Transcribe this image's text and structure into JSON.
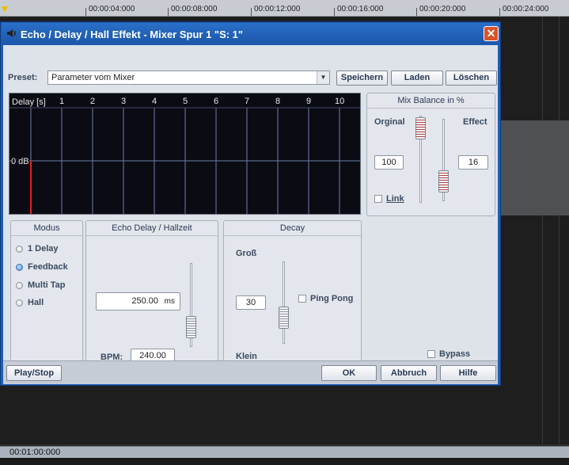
{
  "background": {
    "timeline_labels": [
      "00:00:04:000",
      "00:00:08:000",
      "00:00:12:000",
      "00:00:16:000",
      "00:00:20:000",
      "00:00:24:000"
    ],
    "status_time": "00:01:00:000"
  },
  "dialog": {
    "title": "Echo / Delay / Hall Effekt - Mixer Spur 1 \"S:  1\"",
    "close_glyph": "✕",
    "preset": {
      "label": "Preset:",
      "value": "Parameter vom Mixer",
      "save_label": "Speichern",
      "load_label": "Laden",
      "delete_label": "Löschen"
    },
    "graph": {
      "axis_label": "Delay [s]",
      "ticks": [
        "1",
        "2",
        "3",
        "4",
        "5",
        "6",
        "7",
        "8",
        "9",
        "10"
      ],
      "db_label": "0 dB",
      "impulse_color": "#e02020",
      "grid_color": "#6b7fa8"
    },
    "mix_balance": {
      "title": "Mix Balance in %",
      "original_label": "Orginal",
      "effect_label": "Effect",
      "original_value": "100",
      "effect_value": "16",
      "link_label": "Link"
    },
    "modus": {
      "title": "Modus",
      "options": [
        {
          "label": "1 Delay",
          "selected": false
        },
        {
          "label": "Feedback",
          "selected": true
        },
        {
          "label": "Multi Tap",
          "selected": false
        },
        {
          "label": "Hall",
          "selected": false
        }
      ]
    },
    "echo_delay": {
      "title": "Echo Delay / Hallzeit",
      "value": "250.00",
      "unit": "ms",
      "bpm_label": "BPM:",
      "bpm_value": "240.00"
    },
    "decay": {
      "title": "Decay",
      "gross_label": "Groß",
      "klein_label": "Klein",
      "value": "30",
      "ping_pong_label": "Ping Pong"
    },
    "bypass_label": "Bypass",
    "footer": {
      "play_stop": "Play/Stop",
      "ok": "OK",
      "cancel": "Abbruch",
      "help": "Hilfe"
    }
  }
}
